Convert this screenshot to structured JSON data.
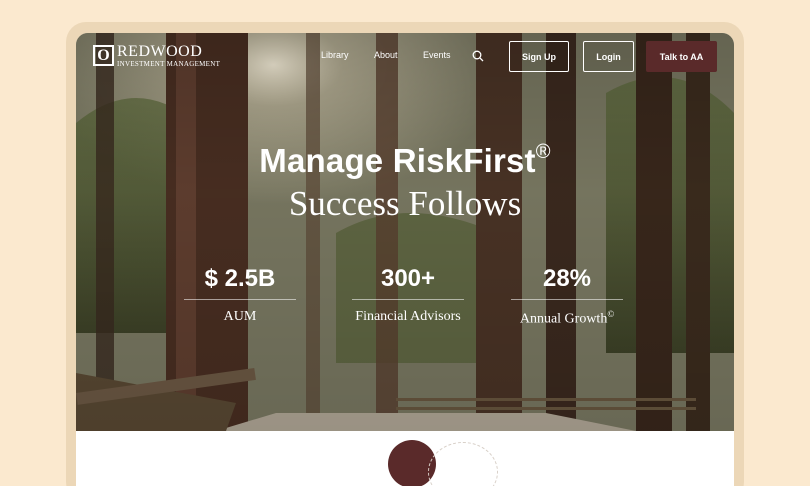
{
  "logo": {
    "mark": "O",
    "name": "REDWOOD",
    "tagline": "INVESTMENT MANAGEMENT"
  },
  "nav": {
    "links": [
      "Library",
      "About",
      "Events"
    ],
    "search_icon": "search-icon",
    "signup_label": "Sign Up",
    "login_label": "Login",
    "cta_label": "Talk to AA"
  },
  "hero": {
    "headline": "Manage RiskFirst",
    "headline_mark": "®",
    "subline": "Success Follows"
  },
  "stats": [
    {
      "value": "$ 2.5B",
      "label": "AUM",
      "mark": ""
    },
    {
      "value": "300+",
      "label": "Financial Advisors",
      "mark": ""
    },
    {
      "value": "28%",
      "label": "Annual Growth",
      "mark": "©"
    }
  ],
  "colors": {
    "page_bg": "#fbe9cf",
    "device": "#ecd7b7",
    "brand": "#5a2a2a"
  }
}
